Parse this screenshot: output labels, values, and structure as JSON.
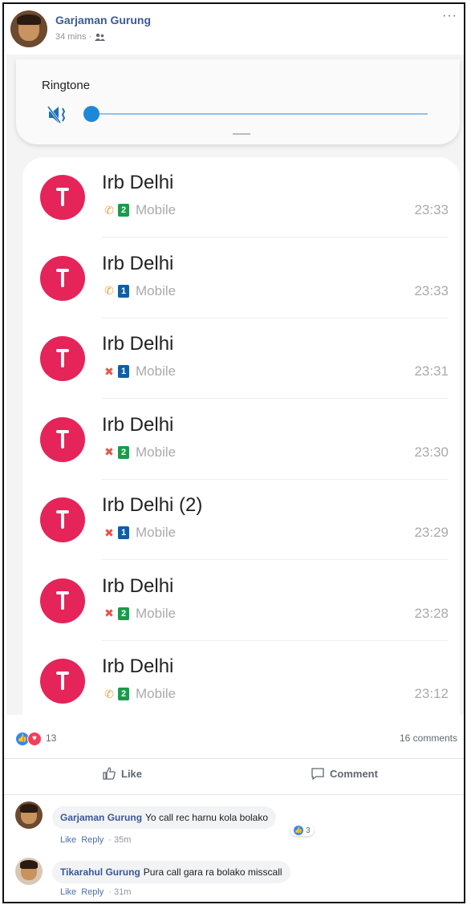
{
  "post": {
    "author": "Garjaman Gurung",
    "time": "34 mins ·",
    "audience_icon": "friends-icon",
    "more_label": "···"
  },
  "ringtone": {
    "title": "Ringtone",
    "icon": "vibrate-icon",
    "volume_level": 0.0
  },
  "calls": [
    {
      "name": "Irb Delhi",
      "type": "outgoing",
      "sim": "2",
      "label": "Mobile",
      "time": "23:33"
    },
    {
      "name": "Irb Delhi",
      "type": "outgoing",
      "sim": "1",
      "label": "Mobile",
      "time": "23:33"
    },
    {
      "name": "Irb Delhi",
      "type": "missed",
      "sim": "1",
      "label": "Mobile",
      "time": "23:31"
    },
    {
      "name": "Irb Delhi",
      "type": "missed",
      "sim": "2",
      "label": "Mobile",
      "time": "23:30"
    },
    {
      "name": "Irb Delhi (2)",
      "type": "missed",
      "sim": "1",
      "label": "Mobile",
      "time": "23:29"
    },
    {
      "name": "Irb Delhi",
      "type": "missed",
      "sim": "2",
      "label": "Mobile",
      "time": "23:28"
    },
    {
      "name": "Irb Delhi",
      "type": "outgoing",
      "sim": "2",
      "label": "Mobile",
      "time": "23:12"
    }
  ],
  "colors": {
    "sim1": "#0d5fa8",
    "sim2": "#1a9b4a",
    "missed": "#e2574c",
    "outgoing": "#e0a64a",
    "avatar": "#e5245a"
  },
  "reactions": {
    "count": "13",
    "comments": "16 comments",
    "like_label": "Like",
    "comment_label": "Comment"
  },
  "comments": [
    {
      "author": "Garjaman Gurung",
      "text": "Yo call rec harnu kola bolako",
      "like": "Like",
      "reply": "Reply",
      "time": "· 35m",
      "reaction_count": "3"
    },
    {
      "author": "Tikarahul Gurung",
      "text": "Pura call gara ra bolako misscall",
      "like": "Like",
      "reply": "Reply",
      "time": "· 31m"
    }
  ]
}
